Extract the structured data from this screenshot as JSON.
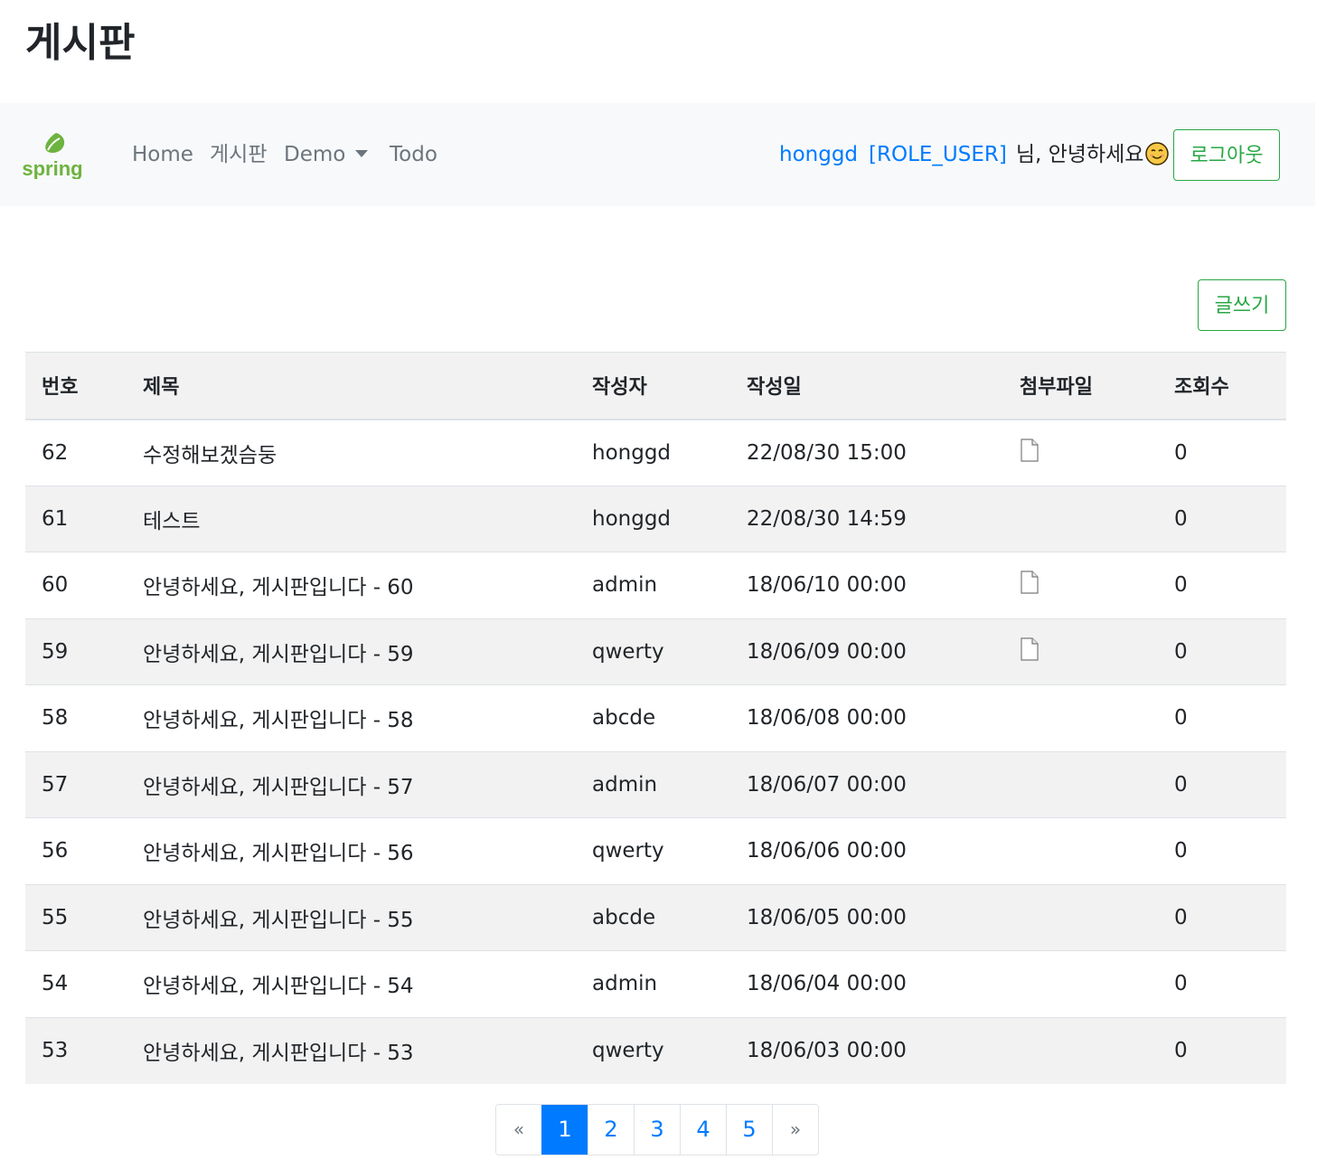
{
  "page": {
    "title": "게시판"
  },
  "navbar": {
    "brand": "spring",
    "links": [
      "Home",
      "게시판",
      "Demo",
      "Todo"
    ],
    "user": {
      "username": "honggd",
      "role": "[ROLE_USER]",
      "greeting": "님, 안녕하세요"
    },
    "logout_label": "로그아웃"
  },
  "board": {
    "write_label": "글쓰기",
    "columns": [
      "번호",
      "제목",
      "작성자",
      "작성일",
      "첨부파일",
      "조회수"
    ],
    "rows": [
      {
        "no": "62",
        "title": "수정해보겠슴둥",
        "writer": "honggd",
        "date": "22/08/30  15:00",
        "attach": true,
        "views": "0"
      },
      {
        "no": "61",
        "title": "테스트",
        "writer": "honggd",
        "date": "22/08/30  14:59",
        "attach": false,
        "views": "0"
      },
      {
        "no": "60",
        "title": "안녕하세요, 게시판입니다 - 60",
        "writer": "admin",
        "date": "18/06/10  00:00",
        "attach": true,
        "views": "0"
      },
      {
        "no": "59",
        "title": "안녕하세요, 게시판입니다 - 59",
        "writer": "qwerty",
        "date": "18/06/09  00:00",
        "attach": true,
        "views": "0"
      },
      {
        "no": "58",
        "title": "안녕하세요, 게시판입니다 - 58",
        "writer": "abcde",
        "date": "18/06/08  00:00",
        "attach": false,
        "views": "0"
      },
      {
        "no": "57",
        "title": "안녕하세요, 게시판입니다 - 57",
        "writer": "admin",
        "date": "18/06/07  00:00",
        "attach": false,
        "views": "0"
      },
      {
        "no": "56",
        "title": "안녕하세요, 게시판입니다 - 56",
        "writer": "qwerty",
        "date": "18/06/06  00:00",
        "attach": false,
        "views": "0"
      },
      {
        "no": "55",
        "title": "안녕하세요, 게시판입니다 - 55",
        "writer": "abcde",
        "date": "18/06/05  00:00",
        "attach": false,
        "views": "0"
      },
      {
        "no": "54",
        "title": "안녕하세요, 게시판입니다 - 54",
        "writer": "admin",
        "date": "18/06/04  00:00",
        "attach": false,
        "views": "0"
      },
      {
        "no": "53",
        "title": "안녕하세요, 게시판입니다 - 53",
        "writer": "qwerty",
        "date": "18/06/03  00:00",
        "attach": false,
        "views": "0"
      }
    ]
  },
  "pagination": {
    "prev": "«",
    "next": "»",
    "pages": [
      "1",
      "2",
      "3",
      "4",
      "5"
    ],
    "current": "1"
  },
  "colors": {
    "accent": "#007bff",
    "success": "#28a745",
    "navbar_bg": "#f8f9fa",
    "stripe": "#f2f2f2"
  },
  "icons": {
    "attachment": "file-icon",
    "greeting": "smiley-icon",
    "brand": "spring-leaf-icon"
  }
}
